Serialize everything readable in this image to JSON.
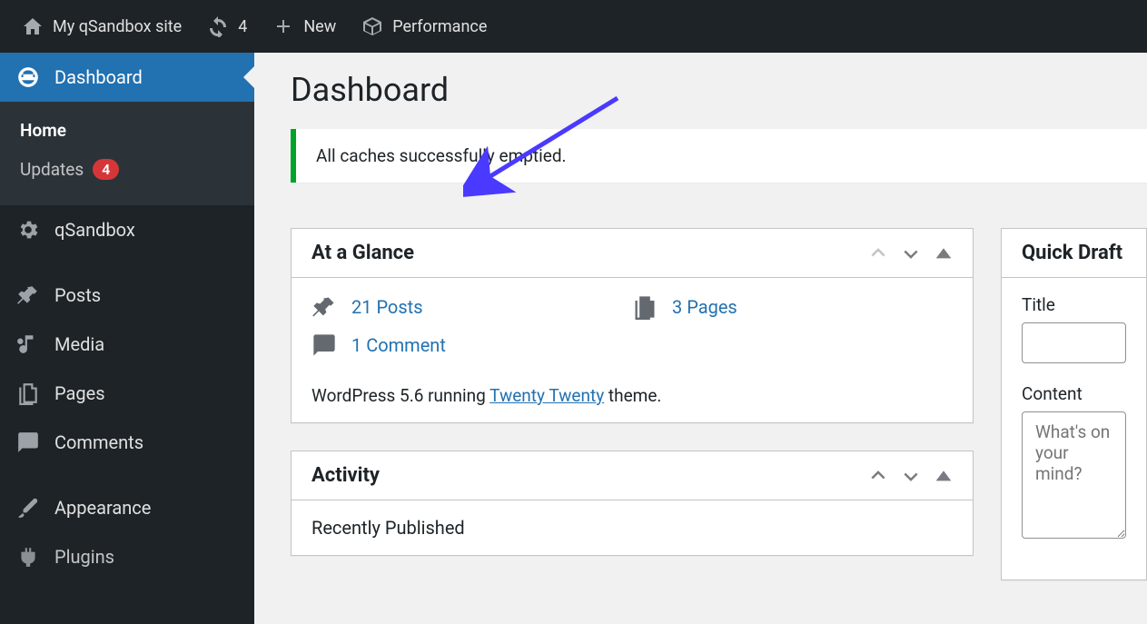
{
  "adminbar": {
    "site_name": "My qSandbox site",
    "updates_count": "4",
    "new_label": "New",
    "performance_label": "Performance"
  },
  "sidebar": {
    "dashboard": "Dashboard",
    "home": "Home",
    "updates": "Updates",
    "updates_count": "4",
    "qsandbox": "qSandbox",
    "posts": "Posts",
    "media": "Media",
    "pages": "Pages",
    "comments": "Comments",
    "appearance": "Appearance",
    "plugins": "Plugins"
  },
  "page": {
    "title": "Dashboard",
    "notice": "All caches successfully emptied."
  },
  "glance": {
    "title": "At a Glance",
    "posts": "21 Posts",
    "pages": "3 Pages",
    "comments": "1 Comment",
    "footer_prefix": "WordPress 5.6 running ",
    "footer_theme": "Twenty Twenty",
    "footer_suffix": " theme."
  },
  "activity": {
    "title": "Activity",
    "recently_published": "Recently Published"
  },
  "quick_draft": {
    "title": "Quick Draft",
    "title_label": "Title",
    "content_label": "Content",
    "content_placeholder": "What's on your mind?"
  }
}
